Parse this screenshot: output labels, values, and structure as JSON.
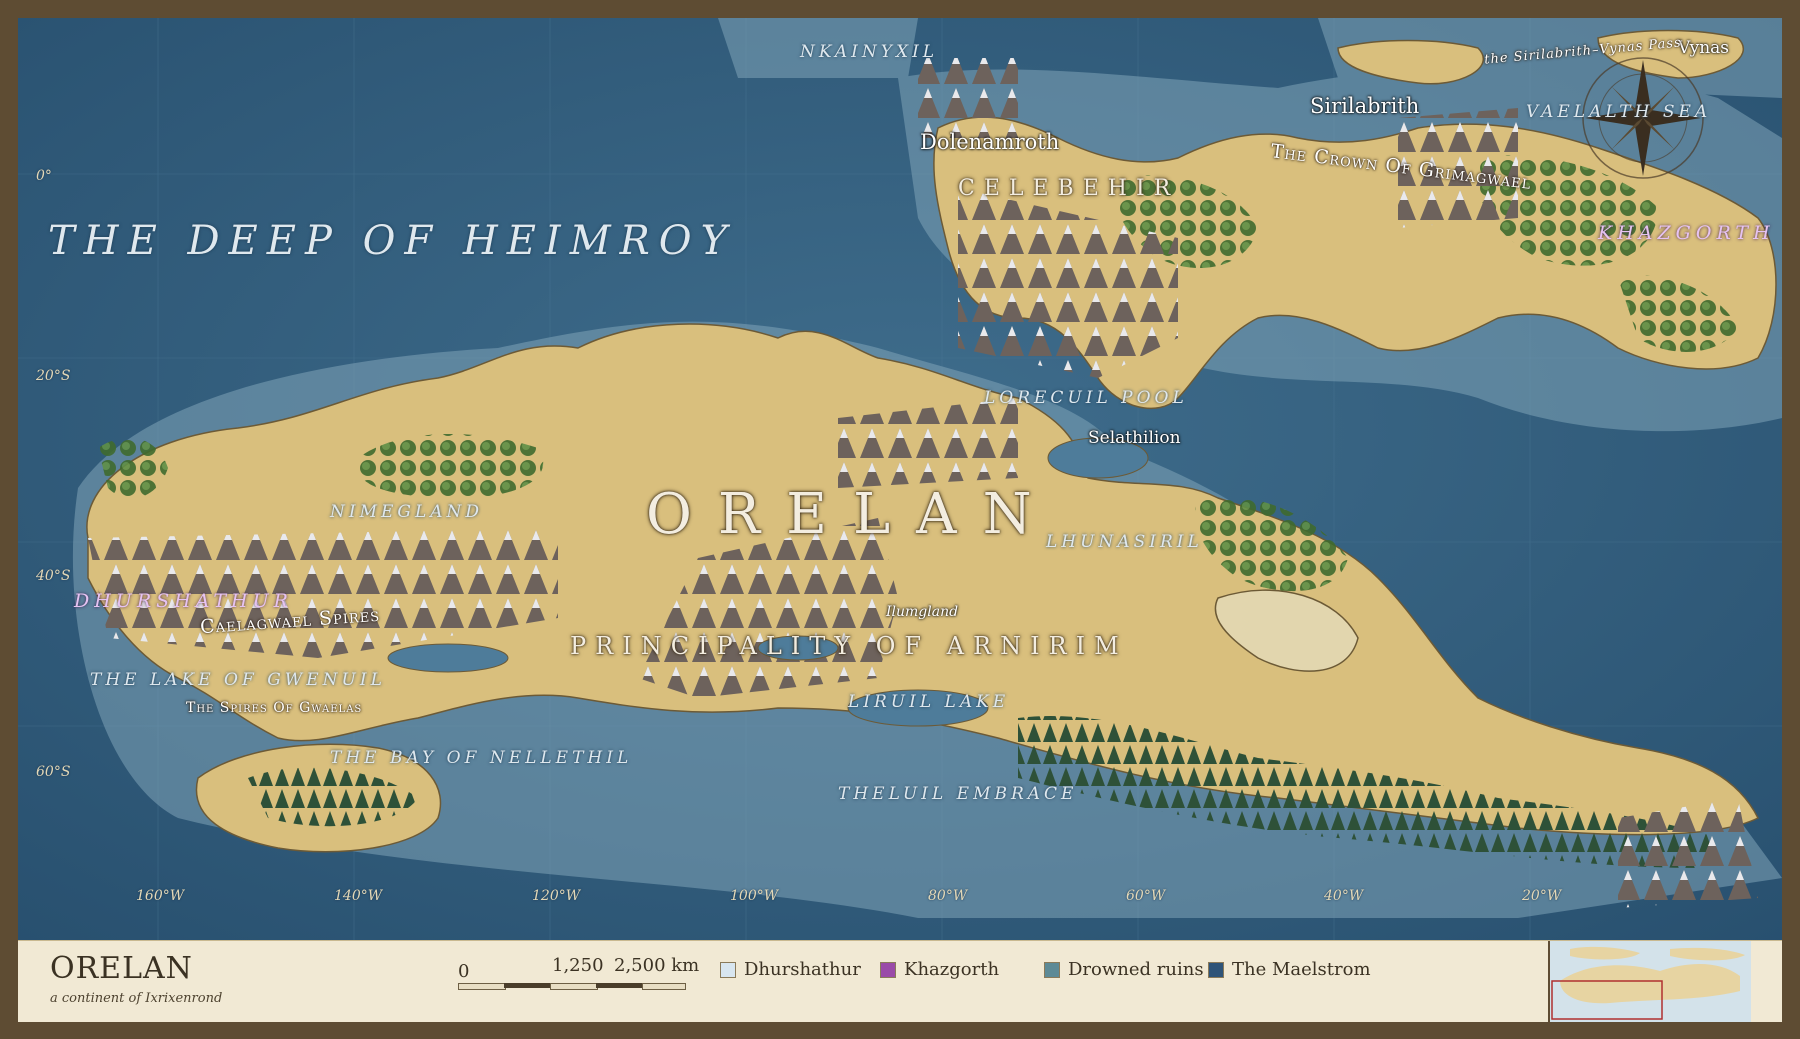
{
  "map": {
    "seas": [
      {
        "id": "deep-heimroy",
        "text": "THE DEEP OF HEIMROY"
      },
      {
        "id": "nkainyxil",
        "text": "NKAINYXIL"
      },
      {
        "id": "vaelal",
        "text": "VAELALTH SEA"
      },
      {
        "id": "nimegland",
        "text": "NIMEGLAND"
      },
      {
        "id": "lorecuil",
        "text": "LORECUIL POOL"
      },
      {
        "id": "lhunasiril",
        "text": "LHUNASIRIL"
      },
      {
        "id": "gwenuil",
        "text": "THE LAKE OF GWENUIL"
      },
      {
        "id": "nellethil",
        "text": "THE BAY OF NELLETHIL"
      },
      {
        "id": "liruil",
        "text": "LIRUIL LAKE"
      },
      {
        "id": "theluil",
        "text": "THELUIL EMBRACE"
      }
    ],
    "regions": [
      {
        "id": "orelan",
        "text": "ORELAN"
      },
      {
        "id": "arnirim",
        "text": "PRINCIPALITY OF ARNIRIM"
      },
      {
        "id": "celebehir",
        "text": "CELEBEHIR"
      }
    ],
    "cities": [
      {
        "id": "dolenamroth",
        "text": "Dolenamroth"
      },
      {
        "id": "sirilabrith",
        "text": "Sirilabrith"
      },
      {
        "id": "selathilion",
        "text": "Selathilion"
      },
      {
        "id": "vynas",
        "text": "Vynas"
      },
      {
        "id": "ilumgland",
        "text": "Ilumgland"
      }
    ],
    "features": [
      {
        "id": "crown",
        "text": "The Crown Of Grimagwael"
      },
      {
        "id": "caelagwael",
        "text": "Caelagwael Spires"
      },
      {
        "id": "gwaelas",
        "text": "The Spires Of Gwaelas"
      },
      {
        "id": "pass",
        "text": "the Sirilabrith–Vynas Pass"
      }
    ],
    "special": [
      {
        "id": "dhurshathur",
        "text": "DHURSHATHUR"
      },
      {
        "id": "khazgorth",
        "text": "KHAZGORTH"
      }
    ],
    "latitudes": [
      "0°",
      "20°S",
      "40°S",
      "60°S"
    ],
    "longitudes": [
      "160°W",
      "140°W",
      "120°W",
      "100°W",
      "80°W",
      "60°W",
      "40°W",
      "20°W"
    ]
  },
  "legend": {
    "title": "ORELAN",
    "subtitle": "a continent of Ixrixenrond",
    "scale": [
      "0",
      "1,250",
      "2,500 km"
    ],
    "keys": [
      {
        "label": "Dhurshathur",
        "color": "#d8e6f0"
      },
      {
        "label": "Khazgorth",
        "color": "#9a4aa8"
      },
      {
        "label": "Drowned ruins",
        "color": "#5d8a96"
      },
      {
        "label": "The Maelstrom",
        "color": "#2f5478"
      }
    ]
  },
  "colors": {
    "ocean": "#2f5a7a",
    "shallows": "#7fa4b8",
    "land": "#d9bf7d",
    "forest": "#4f7a3c",
    "frame": "#5e4c33",
    "parchment": "#f1e9d4"
  }
}
